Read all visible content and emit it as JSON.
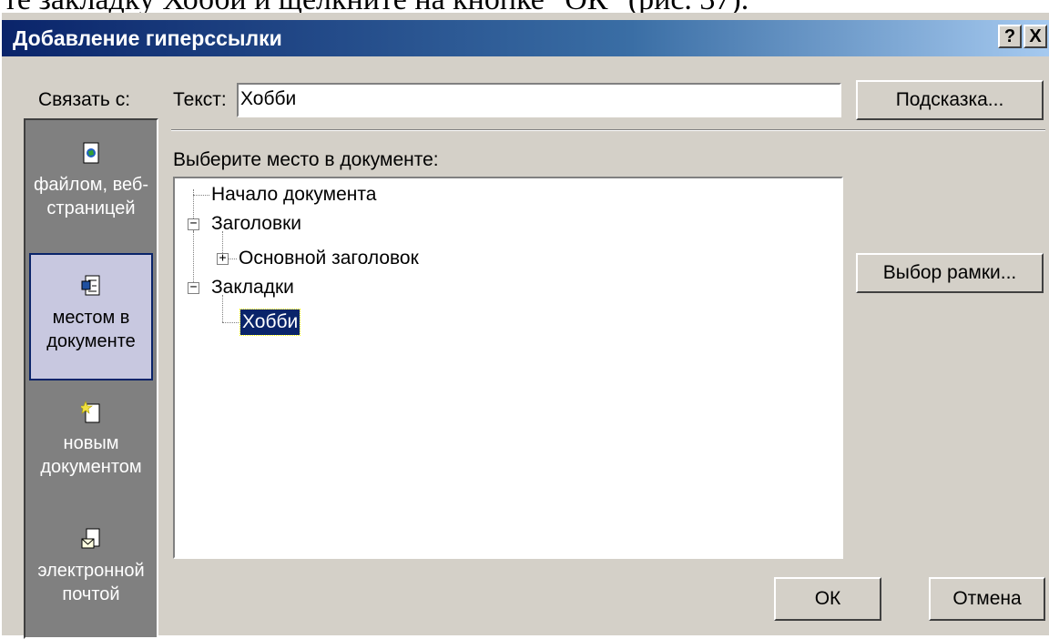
{
  "caption": "те закладку Хобби и щелкните на кнопке \"ОК\" (рис. 37).",
  "window": {
    "title": "Добавление гиперссылки",
    "help_button": "?",
    "close_button": "X"
  },
  "link_to_label": "Связать с:",
  "sidebar": {
    "items": [
      {
        "label": "файлом, веб-страницей",
        "icon": "web-page-icon",
        "selected": false
      },
      {
        "label": "местом в документе",
        "icon": "document-place-icon",
        "selected": true
      },
      {
        "label": "новым документом",
        "icon": "new-document-icon",
        "selected": false
      },
      {
        "label": "электронной почтой",
        "icon": "email-icon",
        "selected": false
      }
    ]
  },
  "text_field": {
    "label": "Текст:",
    "value": "Хобби"
  },
  "hint_button": "Подсказка...",
  "place_label": "Выберите место в документе:",
  "tree": {
    "nodes": [
      {
        "label": "Начало документа",
        "level": 0,
        "expander": ""
      },
      {
        "label": "Заголовки",
        "level": 0,
        "expander": "−"
      },
      {
        "label": "Основной заголовок",
        "level": 1,
        "expander": "+"
      },
      {
        "label": "Закладки",
        "level": 0,
        "expander": "−"
      },
      {
        "label": "Хобби",
        "level": 1,
        "expander": "",
        "selected": true
      }
    ]
  },
  "frame_button": "Выбор рамки...",
  "ok_button": "ОК",
  "cancel_button": "Отмена",
  "colors": {
    "titlebar": "#0a246a",
    "face": "#d4d0c8",
    "selection": "#0a246a"
  }
}
